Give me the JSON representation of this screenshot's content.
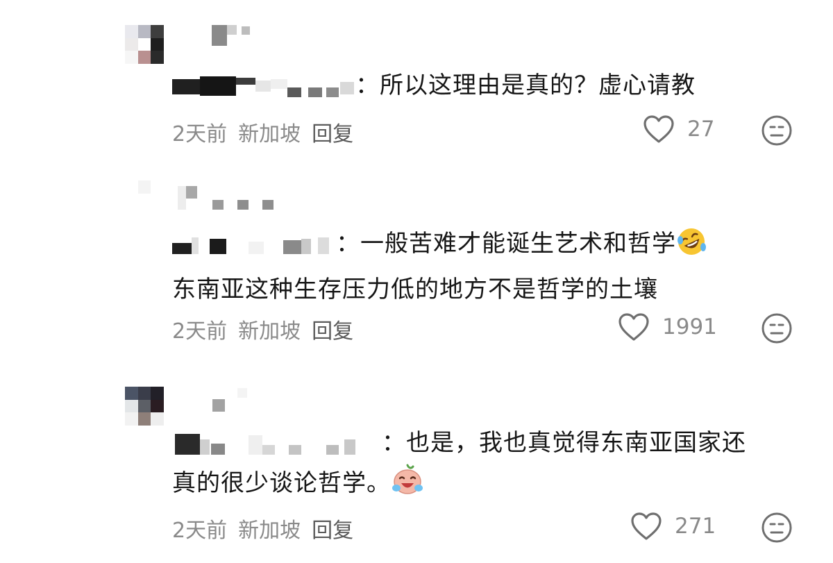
{
  "comments": [
    {
      "text": "：所以这理由是真的？虚心请教",
      "time": "2天前",
      "location": "新加坡",
      "reply_label": "回复",
      "likes": "27"
    },
    {
      "text_line1": "：一般苦难才能诞生艺术和哲学",
      "text_line2": "东南亚这种生存压力低的地方不是哲学的土壤",
      "emoji": "rolling-on-floor-laughing",
      "time": "2天前",
      "location": "新加坡",
      "reply_label": "回复",
      "likes": "1991"
    },
    {
      "text_line1": "：也是，我也真觉得东南亚国家还",
      "text_line2": "真的很少谈论哲学。",
      "emoji": "crying-laughing-sticker",
      "time": "2天前",
      "location": "新加坡",
      "reply_label": "回复",
      "likes": "271"
    }
  ],
  "icons": {
    "like": "heart-outline-icon",
    "dislike": "neutral-face-icon"
  },
  "colors": {
    "text": "#161616",
    "meta": "#8a8a8a",
    "icon": "#6f6f6f"
  }
}
